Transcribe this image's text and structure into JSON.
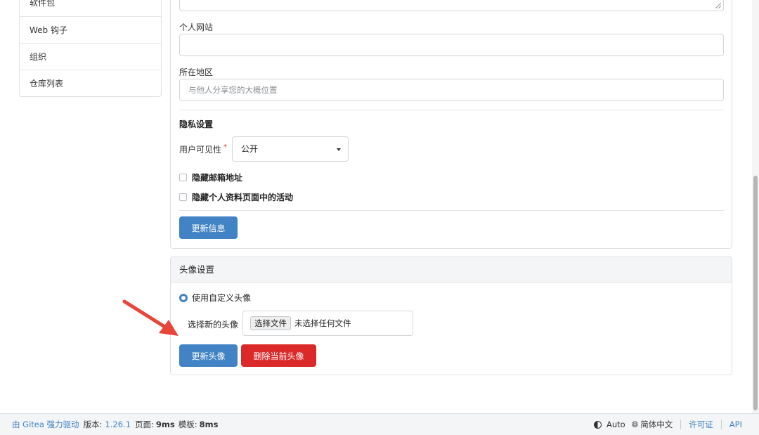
{
  "sidebar": {
    "items": [
      {
        "label": "软件包"
      },
      {
        "label": "Web 钩子"
      },
      {
        "label": "组织"
      },
      {
        "label": "仓库列表"
      }
    ]
  },
  "profile": {
    "website_label": "个人网站",
    "website_value": "",
    "location_label": "所在地区",
    "location_placeholder": "与他人分享您的大概位置",
    "privacy_title": "隐私设置",
    "visibility_label": "用户可见性",
    "required_mark": "*",
    "visibility_value": "公开",
    "hide_email_label": "隐藏邮箱地址",
    "hide_activity_label": "隐藏个人资料页面中的活动",
    "update_button": "更新信息"
  },
  "avatar": {
    "header": "头像设置",
    "custom_avatar_label": "使用自定义头像",
    "choose_label": "选择新的头像",
    "file_button": "选择文件",
    "file_status": "未选择任何文件",
    "update_button": "更新头像",
    "delete_button": "删除当前头像"
  },
  "footer": {
    "powered_by": "由 Gitea 强力驱动",
    "version_label": "版本:",
    "version_value": "1.26.1",
    "page_label": "页面:",
    "page_value": "9ms",
    "template_label": "模板:",
    "template_value": "8ms",
    "theme_label": "Auto",
    "language_label": "简体中文",
    "license_label": "许可证",
    "api_label": "API"
  },
  "colors": {
    "primary": "#4183c4",
    "danger": "#db2828",
    "annotation_arrow": "#e8463a"
  }
}
